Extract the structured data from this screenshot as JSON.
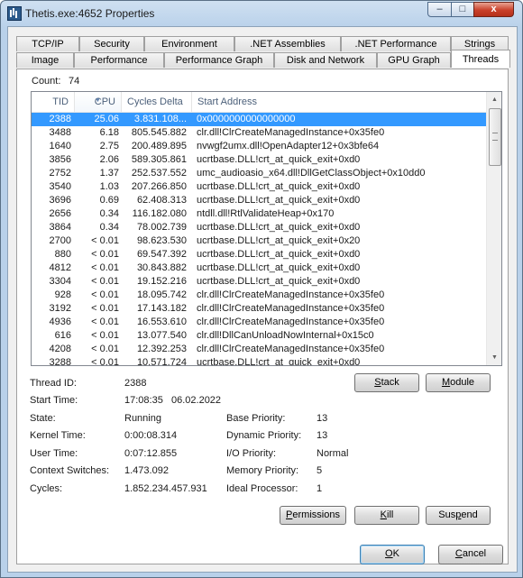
{
  "window": {
    "title": "Thetis.exe:4652 Properties"
  },
  "caption_buttons": {
    "minimize": "–",
    "maximize": "□",
    "close": "x"
  },
  "tabs_row1": [
    "TCP/IP",
    "Security",
    "Environment",
    ".NET Assemblies",
    ".NET Performance",
    "Strings"
  ],
  "tabs_row2": [
    "Image",
    "Performance",
    "Performance Graph",
    "Disk and Network",
    "GPU Graph",
    "Threads"
  ],
  "active_tab": "Threads",
  "count": {
    "label": "Count:",
    "value": "74"
  },
  "columns": {
    "tid": "TID",
    "cpu": "CPU",
    "cycles": "Cycles Delta",
    "start": "Start Address",
    "sorted": "cpu"
  },
  "threads": [
    {
      "tid": "2388",
      "cpu": "25.06",
      "cycles": "3.831.108...",
      "start": "0x0000000000000000",
      "selected": true
    },
    {
      "tid": "3488",
      "cpu": "6.18",
      "cycles": "805.545.882",
      "start": "clr.dll!ClrCreateManagedInstance+0x35fe0"
    },
    {
      "tid": "1640",
      "cpu": "2.75",
      "cycles": "200.489.895",
      "start": "nvwgf2umx.dll!OpenAdapter12+0x3bfe64"
    },
    {
      "tid": "3856",
      "cpu": "2.06",
      "cycles": "589.305.861",
      "start": "ucrtbase.DLL!crt_at_quick_exit+0xd0"
    },
    {
      "tid": "2752",
      "cpu": "1.37",
      "cycles": "252.537.552",
      "start": "umc_audioasio_x64.dll!DllGetClassObject+0x10dd0"
    },
    {
      "tid": "3540",
      "cpu": "1.03",
      "cycles": "207.266.850",
      "start": "ucrtbase.DLL!crt_at_quick_exit+0xd0"
    },
    {
      "tid": "3696",
      "cpu": "0.69",
      "cycles": "62.408.313",
      "start": "ucrtbase.DLL!crt_at_quick_exit+0xd0"
    },
    {
      "tid": "2656",
      "cpu": "0.34",
      "cycles": "116.182.080",
      "start": "ntdll.dll!RtlValidateHeap+0x170"
    },
    {
      "tid": "3864",
      "cpu": "0.34",
      "cycles": "78.002.739",
      "start": "ucrtbase.DLL!crt_at_quick_exit+0xd0"
    },
    {
      "tid": "2700",
      "cpu": "< 0.01",
      "cycles": "98.623.530",
      "start": "ucrtbase.DLL!crt_at_quick_exit+0x20"
    },
    {
      "tid": "880",
      "cpu": "< 0.01",
      "cycles": "69.547.392",
      "start": "ucrtbase.DLL!crt_at_quick_exit+0xd0"
    },
    {
      "tid": "4812",
      "cpu": "< 0.01",
      "cycles": "30.843.882",
      "start": "ucrtbase.DLL!crt_at_quick_exit+0xd0"
    },
    {
      "tid": "3304",
      "cpu": "< 0.01",
      "cycles": "19.152.216",
      "start": "ucrtbase.DLL!crt_at_quick_exit+0xd0"
    },
    {
      "tid": "928",
      "cpu": "< 0.01",
      "cycles": "18.095.742",
      "start": "clr.dll!ClrCreateManagedInstance+0x35fe0"
    },
    {
      "tid": "3192",
      "cpu": "< 0.01",
      "cycles": "17.143.182",
      "start": "clr.dll!ClrCreateManagedInstance+0x35fe0"
    },
    {
      "tid": "4936",
      "cpu": "< 0.01",
      "cycles": "16.553.610",
      "start": "clr.dll!ClrCreateManagedInstance+0x35fe0"
    },
    {
      "tid": "616",
      "cpu": "< 0.01",
      "cycles": "13.077.540",
      "start": "clr.dll!DllCanUnloadNowInternal+0x15c0"
    },
    {
      "tid": "4208",
      "cpu": "< 0.01",
      "cycles": "12.392.253",
      "start": "clr.dll!ClrCreateManagedInstance+0x35fe0"
    },
    {
      "tid": "3288",
      "cpu": "< 0.01",
      "cycles": "10.571.724",
      "start": "ucrtbase.DLL!crt_at_quick_exit+0xd0"
    }
  ],
  "details": {
    "thread_id": {
      "label": "Thread ID:",
      "value": "2388"
    },
    "start_time": {
      "label": "Start Time:",
      "value": "17:08:35   06.02.2022"
    },
    "state": {
      "label": "State:",
      "value": "Running"
    },
    "kernel_time": {
      "label": "Kernel Time:",
      "value": "0:00:08.314"
    },
    "user_time": {
      "label": "User Time:",
      "value": "0:07:12.855"
    },
    "context_switches": {
      "label": "Context Switches:",
      "value": "1.473.092"
    },
    "cycles": {
      "label": "Cycles:",
      "value": "1.852.234.457.931"
    },
    "base_priority": {
      "label": "Base Priority:",
      "value": "13"
    },
    "dynamic_priority": {
      "label": "Dynamic Priority:",
      "value": "13"
    },
    "io_priority": {
      "label": "I/O Priority:",
      "value": "Normal"
    },
    "memory_priority": {
      "label": "Memory Priority:",
      "value": "5"
    },
    "ideal_processor": {
      "label": "Ideal Processor:",
      "value": "1"
    }
  },
  "buttons": {
    "stack": {
      "first": "S",
      "rest": "tack"
    },
    "module": {
      "first": "M",
      "rest": "odule"
    },
    "permissions": {
      "first": "P",
      "rest": "ermissions"
    },
    "kill": {
      "first": "K",
      "rest": "ill"
    },
    "suspend": {
      "pre": "Sus",
      "u": "p",
      "post": "end"
    },
    "ok": {
      "first": "O",
      "rest": "K"
    },
    "cancel": {
      "first": "C",
      "rest": "ancel"
    }
  },
  "scroll": {
    "up": "▲",
    "down": "▼"
  }
}
